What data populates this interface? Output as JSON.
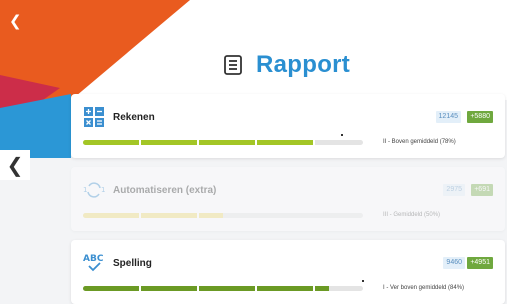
{
  "colors": {
    "accent_blue": "#2a8fd1",
    "deco_orange": "#e95b1f",
    "deco_red": "#cc2d49",
    "deco_blue": "#2b97d6",
    "bar_green": "#a3c626",
    "bar_yellow": "#f0d86a",
    "bar_darkgreen": "#6b9a24",
    "badge_green": "#6fa83e"
  },
  "nav": {
    "back_top_icon": "chevron-left-icon",
    "back_side_icon": "chevron-left-icon"
  },
  "header": {
    "icon": "notebook-icon",
    "title": "Rapport"
  },
  "subjects": [
    {
      "icon": "calculator-icon",
      "title": "Rekenen",
      "score": "12145",
      "delta": "+5880",
      "progress": 0.82,
      "level": "II - Boven gemiddeld (78%)"
    },
    {
      "icon": "refresh-icon",
      "title": "Automatiseren (extra)",
      "score": "2975",
      "delta": "+691",
      "progress": 0.5,
      "level": "III - Gemiddeld (50%)"
    },
    {
      "icon": "abc-spelling-icon",
      "title": "Spelling",
      "score": "9460",
      "delta": "+4951",
      "progress": 0.88,
      "level": "I - Ver boven gemiddeld (84%)"
    }
  ]
}
